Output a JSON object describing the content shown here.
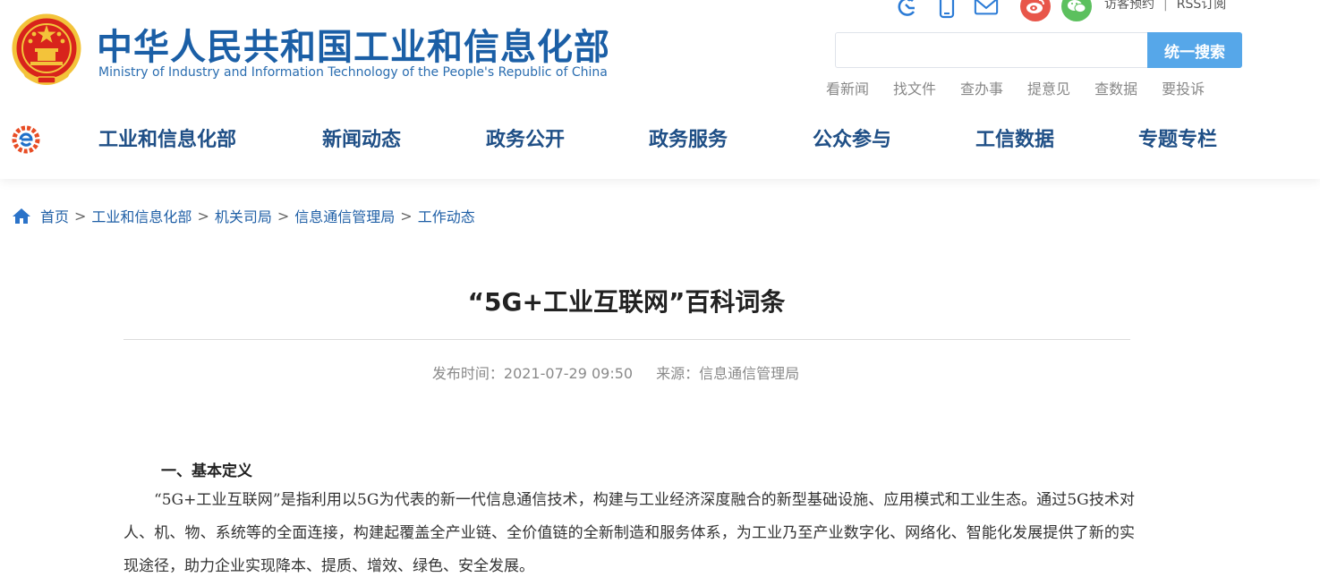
{
  "header": {
    "title_cn": "中华人民共和国工业和信息化部",
    "title_en": "Ministry of Industry and Information Technology of the People's Republic of China",
    "top_icons": [
      "accessibility-icon",
      "mobile-icon",
      "mail-icon",
      "weibo-icon",
      "wechat-icon"
    ],
    "top_links": [
      "访客预约",
      "RSS订阅"
    ],
    "search": {
      "placeholder": "",
      "button_label": "统一搜索"
    },
    "quick_links": [
      "看新闻",
      "找文件",
      "查办事",
      "提意见",
      "查数据",
      "要投诉"
    ],
    "nav_items": [
      "工业和信息化部",
      "新闻动态",
      "政务公开",
      "政务服务",
      "公众参与",
      "工信数据",
      "专题专栏"
    ]
  },
  "breadcrumb": [
    "首页",
    "工业和信息化部",
    "机关司局",
    "信息通信管理局",
    "工作动态"
  ],
  "article": {
    "title": "“5G+工业互联网”百科词条",
    "publish_label": "发布时间：",
    "publish_time": "2021-07-29 09:50",
    "source_label": "来源：",
    "source": "信息通信管理局",
    "section_heading": "一、基本定义",
    "paragraph": "“5G+工业互联网”是指利用以5G为代表的新一代信息通信技术，构建与工业经济深度融合的新型基础设施、应用模式和工业生态。通过5G技术对人、机、物、系统等的全面连接，构建起覆盖全产业链、全价值链的全新制造和服务体系，为工业乃至产业数字化、网络化、智能化发展提供了新的实现途径，助力企业实现降本、提质、增效、绿色、安全发展。"
  },
  "colors": {
    "brand_blue": "#1b5fa6",
    "nav_text": "#1f4f86",
    "search_button": "#56a7e9",
    "emblem_red": "#d8231c",
    "emblem_gold": "#f3c33a"
  }
}
